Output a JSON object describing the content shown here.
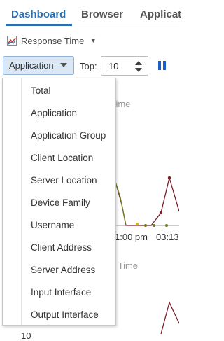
{
  "tabs": [
    "Dashboard",
    "Browser",
    "Applicat"
  ],
  "metric": {
    "label": "Response Time"
  },
  "toolbar": {
    "group_by": "Application",
    "top_label": "Top:",
    "top_value": "10"
  },
  "chart": {
    "title_fragment_1": "Time",
    "title_fragment_2": "e Time",
    "time_label": "1:00 pm",
    "time_label_2": "03:13",
    "y_tick": "10",
    "line_color": "#7a1c2a",
    "line_color_2": "#6b7a1f",
    "marker_color": "#d6b300"
  },
  "menu": {
    "items": [
      "Total",
      "Application",
      "Application Group",
      "Client Location",
      "Server Location",
      "Device Family",
      "Username",
      "Client Address",
      "Server Address",
      "Input Interface",
      "Output Interface"
    ]
  }
}
